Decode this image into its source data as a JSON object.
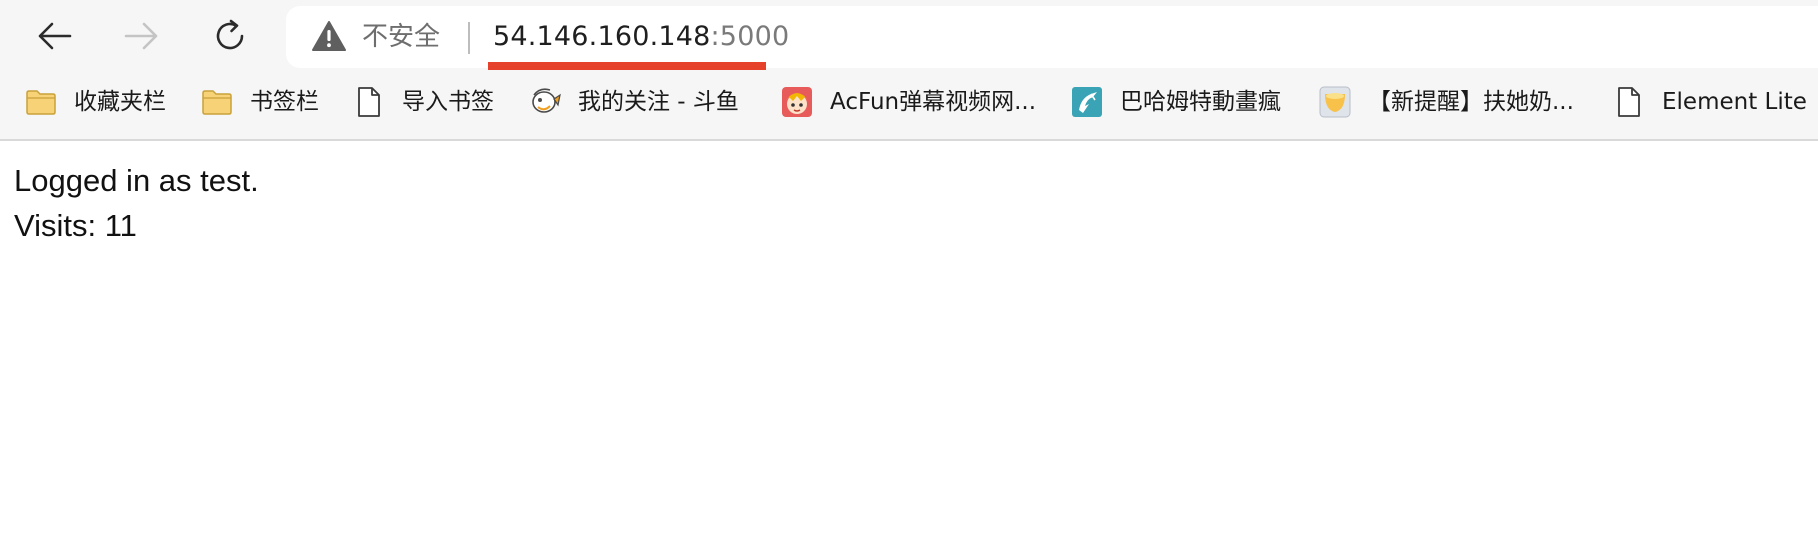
{
  "toolbar": {
    "back_icon": "arrow-left-icon",
    "forward_icon": "arrow-right-icon",
    "reload_icon": "reload-icon"
  },
  "address_bar": {
    "security_icon": "warning-triangle-icon",
    "security_label": "不安全",
    "url_host": "54.146.160.148",
    "url_port": ":5000",
    "underline_color": "#e5412b"
  },
  "bookmarks": [
    {
      "label": "收藏夹栏",
      "icon": "folder-icon"
    },
    {
      "label": "书签栏",
      "icon": "folder-icon"
    },
    {
      "label": "导入书签",
      "icon": "page-icon"
    },
    {
      "label": "我的关注 - 斗鱼",
      "icon": "douyu-fish-icon"
    },
    {
      "label": "AcFun弹幕视频网...",
      "icon": "acfun-icon"
    },
    {
      "label": "巴哈姆特動畫瘋",
      "icon": "bahamut-icon"
    },
    {
      "label": "【新提醒】扶她奶...",
      "icon": "site-favicon-icon"
    },
    {
      "label": "Element Lite",
      "icon": "page-icon"
    }
  ],
  "page": {
    "line1": "Logged in as test.",
    "line2": "Visits: 11"
  }
}
